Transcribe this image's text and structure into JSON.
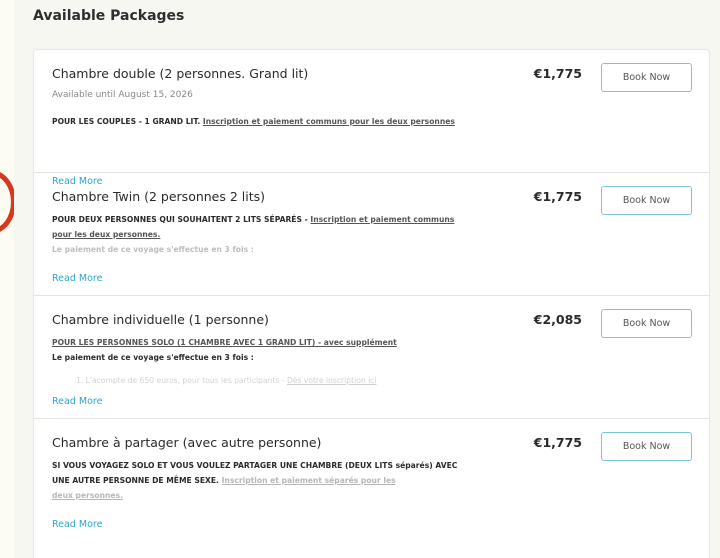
{
  "section": {
    "title": "Available Packages"
  },
  "packages": [
    {
      "name": "Chambre double (2 personnes. Grand lit)",
      "price": "€1,775",
      "button": "Book Now",
      "availability": "Available until August 15, 2026",
      "desc_a": "POUR LES COUPLES - 1 GRAND LIT. ",
      "desc_b": "Inscription et paiement communs pour les deux personnes",
      "read_more": "Read More"
    },
    {
      "name": "Chambre Twin (2 personnes 2 lits)",
      "price": "€1,775",
      "button": "Book Now",
      "desc_a": "POUR DEUX PERSONNES QUI SOUHAITENT 2 LITS SÉPARÉS - ",
      "desc_b": "Inscription et paiement communs pour les deux personnes.",
      "desc_c": "Le paiement de ce voyage s'effectue en 3 fois :",
      "read_more": "Read More"
    },
    {
      "name": "Chambre individuelle (1 personne)",
      "price": "€2,085",
      "button": "Book Now",
      "desc_b": "POUR LES PERSONNES SOLO (1 CHAMBRE AVEC 1 GRAND LIT) - avec supplément",
      "desc_c": "Le paiement de ce voyage s'effectue en 3 fois :",
      "desc_d": "1. L'acompte de 650 euros, pour tous les participants - ",
      "desc_e": "Dès votre inscription ici",
      "read_more": "Read More"
    },
    {
      "name": "Chambre à partager (avec autre personne)",
      "price": "€1,775",
      "button": "Book Now",
      "desc_a": "SI VOUS VOYAGEZ SOLO ET VOUS VOULEZ PARTAGER UNE CHAMBRE (DEUX LITS séparés) AVEC UNE AUTRE PERSONNE DE MÊME SEXE. ",
      "desc_b": "Inscription et paiement séparés pour les",
      "desc_c": "deux personnes.",
      "read_more": "Read More"
    }
  ]
}
